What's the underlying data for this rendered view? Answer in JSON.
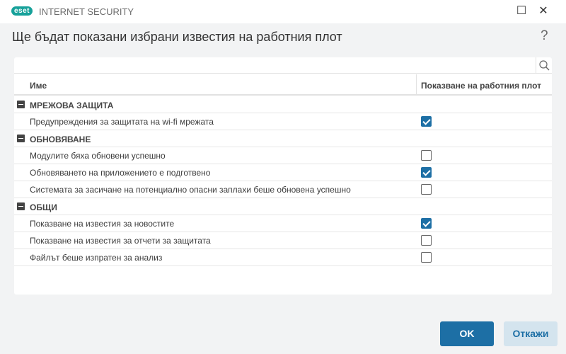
{
  "app": {
    "logo": "eset",
    "name": "INTERNET SECURITY"
  },
  "window": {
    "minimize": "_",
    "maximize": "☐",
    "close": "✕"
  },
  "dialog": {
    "title": "Ще бъдат показани избрани известия на работния плот",
    "help": "?"
  },
  "search": {
    "placeholder": ""
  },
  "table": {
    "col_name": "Име",
    "col_show": "Показване на работния плот",
    "groups": [
      {
        "label": "МРЕЖОВА ЗАЩИТА",
        "items": [
          {
            "label": "Предупреждения за защитата на wi-fi мрежата",
            "checked": true
          }
        ]
      },
      {
        "label": "ОБНОВЯВАНЕ",
        "items": [
          {
            "label": "Модулите бяха обновени успешно",
            "checked": false
          },
          {
            "label": "Обновяването на приложението е подготвено",
            "checked": true
          },
          {
            "label": "Системата за засичане на потенциално опасни заплахи беше обновена успешно",
            "checked": false
          }
        ]
      },
      {
        "label": "ОБЩИ",
        "items": [
          {
            "label": "Показване на известия за новостите",
            "checked": true
          },
          {
            "label": "Показване на известия за отчети за защитата",
            "checked": false
          },
          {
            "label": "Файлът беше изпратен за анализ",
            "checked": false
          }
        ]
      }
    ]
  },
  "buttons": {
    "ok": "OK",
    "cancel": "Откажи"
  },
  "colors": {
    "accent": "#1d6fa5",
    "brand": "#17a19a"
  }
}
